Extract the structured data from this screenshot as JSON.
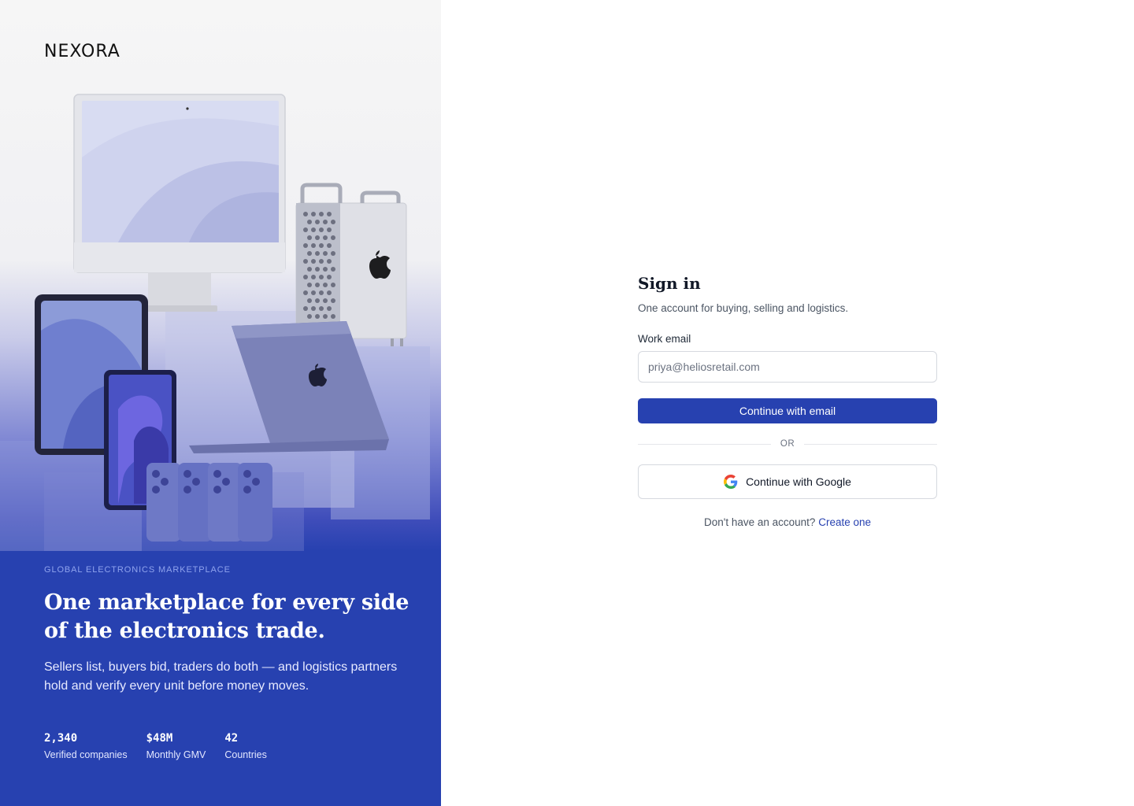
{
  "brand": {
    "logo_text": "NEXORA"
  },
  "hero": {
    "eyebrow": "GLOBAL ELECTRONICS MARKETPLACE",
    "headline": "One marketplace for every side of the electronics trade.",
    "subcopy": "Sellers list, buyers bid, traders do both — and logistics partners hold and verify every unit before money moves.",
    "stats": [
      {
        "value": "2,340",
        "label": "Verified companies"
      },
      {
        "value": "$48M",
        "label": "Monthly GMV"
      },
      {
        "value": "42",
        "label": "Countries"
      }
    ],
    "image_icons": [
      "imac-icon",
      "mac-pro-icon",
      "ipad-icon",
      "macbook-icon",
      "iphone-icon"
    ]
  },
  "signin": {
    "title": "Sign in",
    "subtitle": "One account for buying, selling and logistics.",
    "email_label": "Work email",
    "email_placeholder": "priya@heliosretail.com",
    "email_value": "",
    "continue_email": "Continue with email",
    "or": "OR",
    "continue_google": "Continue with Google",
    "footer_prompt": "Don't have an account?",
    "footer_link": "Create one"
  },
  "colors": {
    "accent": "#2741b0",
    "eyebrow": "#8fa3ee",
    "text_primary": "#111827",
    "text_muted": "#4b5563",
    "border": "#d6d9df"
  }
}
